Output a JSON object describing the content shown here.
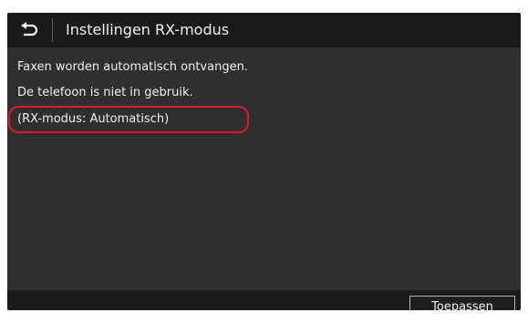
{
  "header": {
    "back_icon": "return-arrow-icon",
    "title": "Instellingen RX-modus"
  },
  "content": {
    "lines": [
      "Faxen worden automatisch ontvangen.",
      "De telefoon is niet in gebruik.",
      "(RX-modus: Automatisch)"
    ],
    "highlight_color": "#e2172b"
  },
  "footer": {
    "apply_label": "Toepassen"
  }
}
